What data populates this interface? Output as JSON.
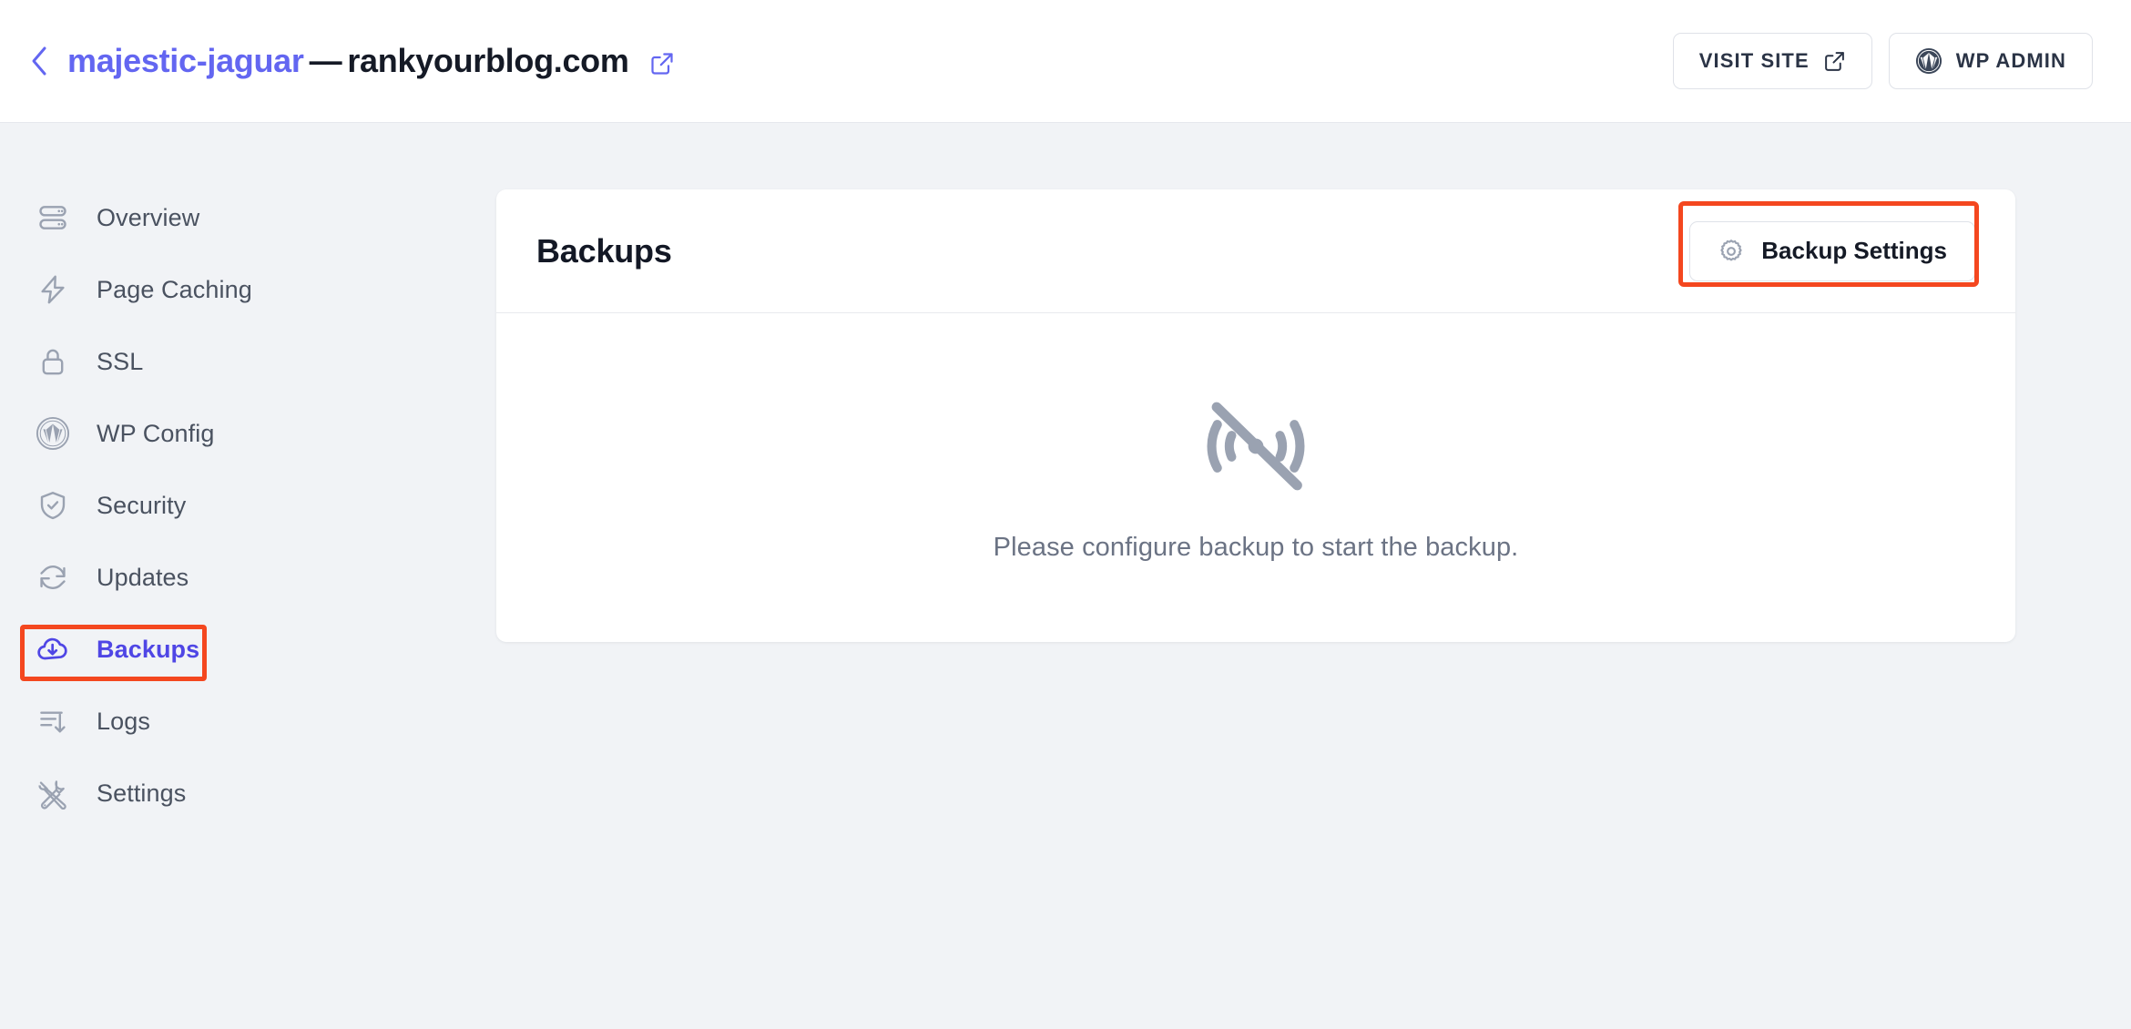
{
  "header": {
    "back_icon": "chevron-left-icon",
    "site_name": "majestic-jaguar",
    "separator": "—",
    "site_domain": "rankyourblog.com",
    "external_link_icon": "external-link-icon",
    "visit_site_label": "VISIT SITE",
    "visit_site_icon": "external-link-icon",
    "wp_admin_label": "WP ADMIN",
    "wp_admin_icon": "wordpress-icon"
  },
  "sidebar": {
    "items": [
      {
        "label": "Overview",
        "icon": "server-icon",
        "active": false
      },
      {
        "label": "Page Caching",
        "icon": "lightning-bolt-icon",
        "active": false
      },
      {
        "label": "SSL",
        "icon": "lock-icon",
        "active": false
      },
      {
        "label": "WP Config",
        "icon": "wordpress-icon",
        "active": false
      },
      {
        "label": "Security",
        "icon": "shield-check-icon",
        "active": false
      },
      {
        "label": "Updates",
        "icon": "refresh-icon",
        "active": false
      },
      {
        "label": "Backups",
        "icon": "cloud-download-icon",
        "active": true
      },
      {
        "label": "Logs",
        "icon": "list-arrow-down-icon",
        "active": false
      },
      {
        "label": "Settings",
        "icon": "tools-icon",
        "active": false
      }
    ]
  },
  "main": {
    "card_title": "Backups",
    "backup_settings_label": "Backup Settings",
    "backup_settings_icon": "gear-icon",
    "empty_state_icon": "signal-off-icon",
    "empty_state_text": "Please configure backup to start the backup."
  },
  "annotations": [
    {
      "name": "backups-nav-highlight",
      "color": "#f4471f"
    },
    {
      "name": "backup-settings-highlight",
      "color": "#f4471f"
    }
  ],
  "colors": {
    "accent_indigo": "#6366f1",
    "active_indigo": "#4f46e5",
    "annotation_orange": "#f4471f",
    "page_background": "#f1f3f6",
    "text_dark": "#151a26",
    "text_muted": "#6b7384",
    "icon_gray": "#9aa2b1"
  }
}
